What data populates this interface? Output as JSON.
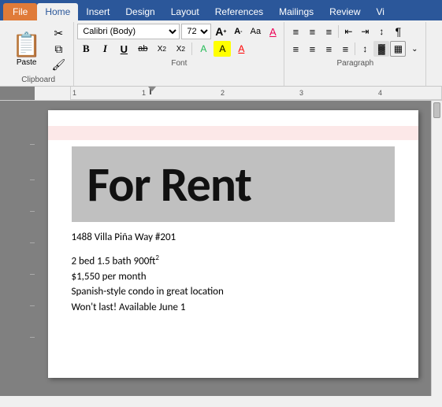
{
  "tabs": [
    {
      "label": "File",
      "id": "file",
      "active": false
    },
    {
      "label": "Home",
      "id": "home",
      "active": true
    },
    {
      "label": "Insert",
      "id": "insert",
      "active": false
    },
    {
      "label": "Design",
      "id": "design",
      "active": false
    },
    {
      "label": "Layout",
      "id": "layout",
      "active": false
    },
    {
      "label": "References",
      "id": "references",
      "active": false
    },
    {
      "label": "Mailings",
      "id": "mailings",
      "active": false
    },
    {
      "label": "Review",
      "id": "review",
      "active": false
    },
    {
      "label": "Vi",
      "id": "view",
      "active": false
    }
  ],
  "clipboard": {
    "label": "Clipboard",
    "paste_label": "Paste",
    "cut_icon": "✂",
    "copy_icon": "⧉",
    "format_painter_icon": "🖌"
  },
  "font": {
    "label": "Font",
    "name": "Calibri (Body)",
    "size": "72",
    "grow_icon": "A",
    "shrink_icon": "A",
    "case_icon": "Aa",
    "clear_icon": "A",
    "bold": "B",
    "italic": "I",
    "underline": "U",
    "strikethrough": "ab",
    "subscript": "X₂",
    "superscript": "X²",
    "text_color_icon": "A",
    "highlight_icon": "A",
    "font_color_icon": "A"
  },
  "paragraph": {
    "label": "Paragraph",
    "bullets_icon": "≡",
    "numbering_icon": "≡",
    "multilevel_icon": "≡",
    "indent_dec_icon": "←",
    "indent_inc_icon": "→",
    "sort_icon": "↕",
    "marks_icon": "¶",
    "align_left": "≡",
    "align_center": "≡",
    "align_right": "≡",
    "justify": "≡",
    "line_spacing": "↕",
    "shading": "▓",
    "borders": "▦"
  },
  "document": {
    "for_rent_text": "For Rent",
    "address": "1488 Villa Piña Way #201",
    "bed_bath": "2 bed 1.5 bath 900ft",
    "sq_superscript": "2",
    "price": "$1,550 per month",
    "description": "Spanish-style condo in great location",
    "availability": "Won't last! Available June 1"
  },
  "ruler": {
    "markers": []
  }
}
